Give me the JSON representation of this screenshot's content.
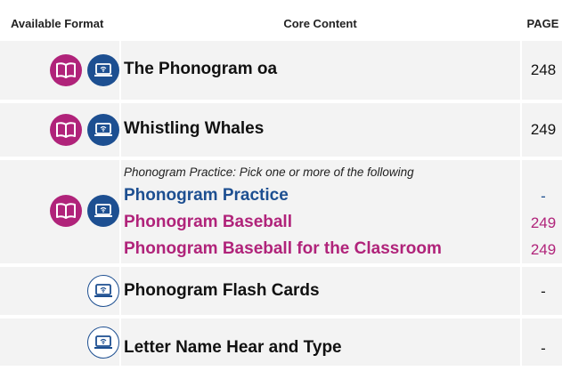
{
  "header": {
    "col_format": "Available Format",
    "col_content": "Core Content",
    "col_page": "PAGE"
  },
  "rows": [
    {
      "title": "The Phonogram oa",
      "page": "248",
      "formats": [
        "book-icon",
        "digital-icon"
      ]
    },
    {
      "title": "Whistling Whales",
      "page": "249",
      "formats": [
        "book-icon",
        "digital-icon"
      ]
    },
    {
      "intro": "Phonogram Practice: Pick one or more of the following",
      "items": [
        {
          "title": "Phonogram Practice",
          "page": "-"
        },
        {
          "title": "Phonogram Baseball",
          "page": "249"
        },
        {
          "title": "Phonogram Baseball for the Classroom",
          "page": "249"
        }
      ],
      "formats": [
        "book-icon",
        "digital-icon"
      ]
    },
    {
      "title": "Phonogram Flash Cards",
      "page": "-",
      "formats": [
        "digital-outline-icon"
      ]
    },
    {
      "title": "Letter Name Hear and Type",
      "page": "-",
      "formats": [
        "digital-outline-icon"
      ]
    }
  ],
  "colors": {
    "row_bg": "#f3f3f3",
    "magenta": "#b0237a",
    "blue": "#1d4f91"
  }
}
